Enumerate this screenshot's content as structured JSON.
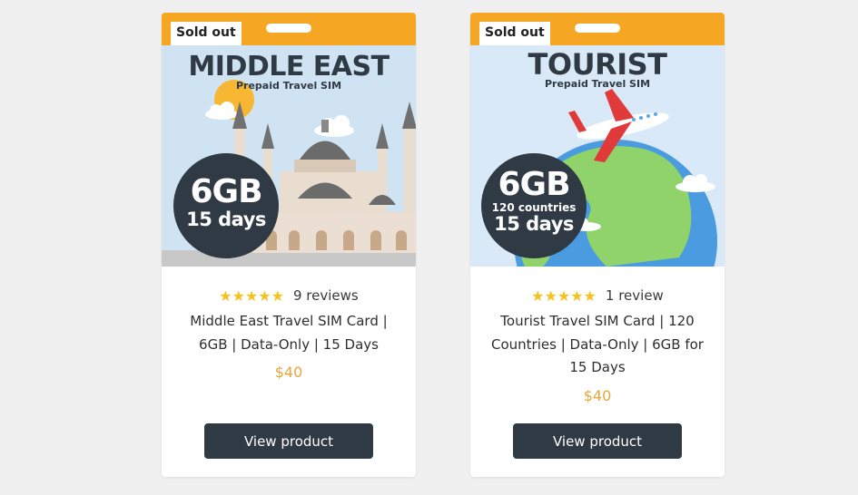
{
  "colors": {
    "page_background": "#f0f0f1",
    "header_strip": "#f5a623",
    "badge": "#2f3a45",
    "stars": "#f6c21f",
    "price": "#e6a63b",
    "button": "#2f3a45"
  },
  "products": [
    {
      "sold_out": "Sold out",
      "image": {
        "title": "MIDDLE EAST",
        "subtitle": "Prepaid Travel SIM",
        "data": "6GB",
        "duration": "15 days",
        "illustration": "mosque-icon"
      },
      "stars": "★★★★★",
      "rating": 5,
      "reviews": "9 reviews",
      "title": "Middle East Travel SIM Card | 6GB | Data-Only | 15 Days",
      "price": "$40",
      "button": "View product"
    },
    {
      "sold_out": "Sold out",
      "image": {
        "title": "TOURIST",
        "subtitle": "Prepaid Travel SIM",
        "data": "6GB",
        "countries": "120 countries",
        "duration": "15 days",
        "illustration": "globe-airplane-icon"
      },
      "stars": "★★★★★",
      "rating": 5,
      "reviews": "1 review",
      "title": "Tourist Travel SIM Card | 120 Countries | Data-Only | 6GB for 15 Days",
      "price": "$40",
      "button": "View product"
    }
  ]
}
